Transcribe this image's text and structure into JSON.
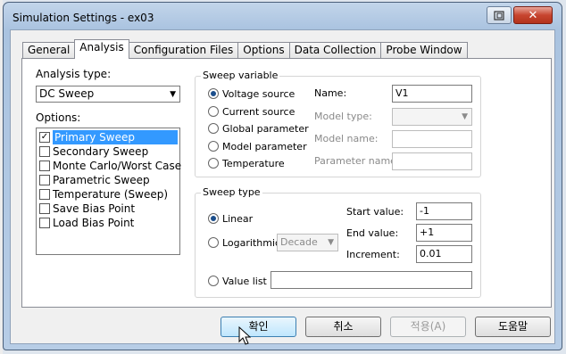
{
  "window": {
    "title": "Simulation Settings - ex03",
    "close_glyph": "✕"
  },
  "tabs": [
    {
      "label": "General"
    },
    {
      "label": "Analysis"
    },
    {
      "label": "Configuration Files"
    },
    {
      "label": "Options"
    },
    {
      "label": "Data Collection"
    },
    {
      "label": "Probe Window"
    }
  ],
  "analysis": {
    "type_label": "Analysis type:",
    "type_value": "DC Sweep",
    "options_label": "Options:",
    "options": [
      {
        "label": "Primary Sweep",
        "checked": true
      },
      {
        "label": "Secondary Sweep",
        "checked": false
      },
      {
        "label": "Monte Carlo/Worst Case",
        "checked": false
      },
      {
        "label": "Parametric Sweep",
        "checked": false
      },
      {
        "label": "Temperature (Sweep)",
        "checked": false
      },
      {
        "label": "Save Bias Point",
        "checked": false
      },
      {
        "label": "Load Bias Point",
        "checked": false
      }
    ]
  },
  "sweep_variable": {
    "title": "Sweep variable",
    "radios": [
      {
        "label": "Voltage source",
        "checked": true
      },
      {
        "label": "Current source",
        "checked": false
      },
      {
        "label": "Global parameter",
        "checked": false
      },
      {
        "label": "Model parameter",
        "checked": false
      },
      {
        "label": "Temperature",
        "checked": false
      }
    ],
    "name_label": "Name:",
    "name_value": "V1",
    "model_type_label": "Model type:",
    "model_name_label": "Model name:",
    "parameter_name_label": "Parameter name:"
  },
  "sweep_type": {
    "title": "Sweep type",
    "linear_label": "Linear",
    "log_label": "Logarithmic",
    "log_scale": "Decade",
    "value_list_label": "Value list",
    "start_label": "Start value:",
    "start_value": "-1",
    "end_label": "End value:",
    "end_value": "+1",
    "increment_label": "Increment:",
    "increment_value": "0.01"
  },
  "buttons": {
    "ok": "확인",
    "cancel": "취소",
    "apply": "적용(A)",
    "help": "도움말"
  },
  "colors": {
    "selection": "#3399ff",
    "close_button": "#c7452f"
  }
}
